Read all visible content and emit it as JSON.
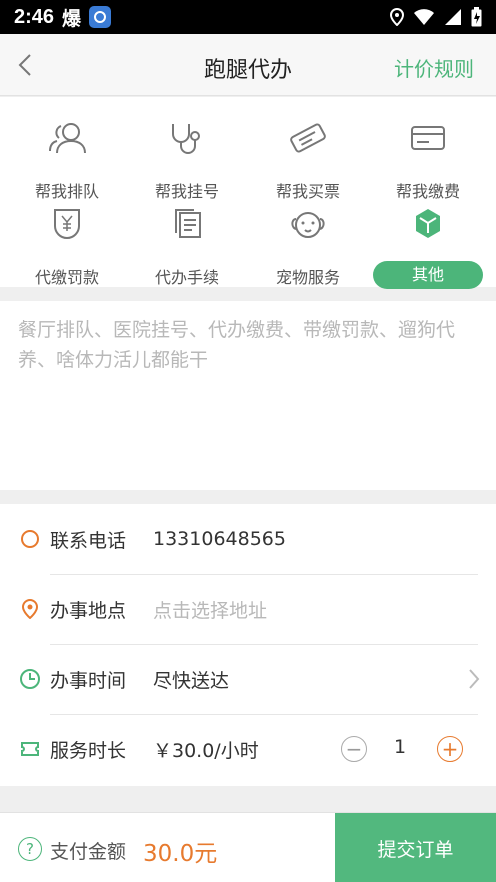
{
  "status": {
    "time": "2:46",
    "app_glyph": "爆"
  },
  "header": {
    "title": "跑腿代办",
    "pricing_link": "计价规则"
  },
  "categories": [
    {
      "label": "帮我排队",
      "icon": "people-icon"
    },
    {
      "label": "帮我挂号",
      "icon": "stethoscope-icon"
    },
    {
      "label": "帮我买票",
      "icon": "ticket-icon"
    },
    {
      "label": "帮我缴费",
      "icon": "card-icon"
    },
    {
      "label": "代缴罚款",
      "icon": "yen-shield-icon"
    },
    {
      "label": "代办手续",
      "icon": "document-icon"
    },
    {
      "label": "宠物服务",
      "icon": "dog-icon"
    },
    {
      "label": "其他",
      "icon": "cube-icon",
      "active": true
    }
  ],
  "description": {
    "placeholder": "餐厅排队、医院挂号、代办缴费、带缴罚款、遛狗代养、啥体力活儿都能干"
  },
  "form": {
    "phone": {
      "label": "联系电话",
      "value": "13310648565"
    },
    "location": {
      "label": "办事地点",
      "placeholder": "点击选择地址"
    },
    "time": {
      "label": "办事时间",
      "value": "尽快送达"
    },
    "duration": {
      "label": "服务时长",
      "price": "￥30.0/小时",
      "quantity": "1"
    }
  },
  "footer": {
    "pay_label": "支付金额",
    "amount": "30.0元",
    "submit": "提交订单"
  },
  "colors": {
    "accent": "#4cb57a",
    "orange": "#e77a2e"
  }
}
